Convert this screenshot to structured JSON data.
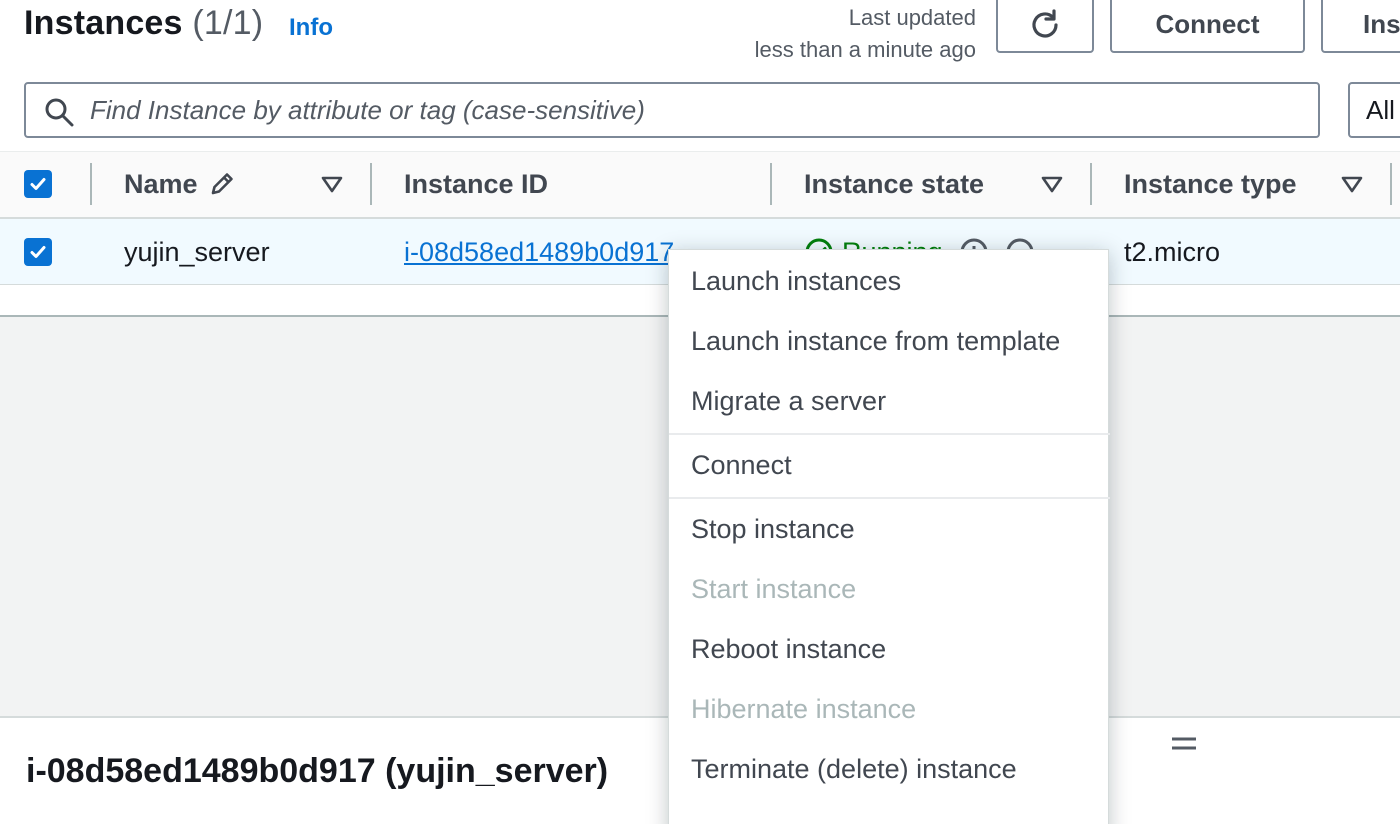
{
  "header": {
    "title": "Instances",
    "count": "(1/1)",
    "info_link": "Info",
    "last_updated_line1": "Last updated",
    "last_updated_line2": "less than a minute ago",
    "refresh_icon": "refresh-icon",
    "connect_label": "Connect",
    "launch_label": "Ins"
  },
  "search": {
    "placeholder": "Find Instance by attribute or tag (case-sensitive)",
    "filter_value": "All"
  },
  "table": {
    "columns": [
      "Name",
      "Instance ID",
      "Instance state",
      "Instance type"
    ],
    "rows": [
      {
        "name": "yujin_server",
        "instance_id": "i-08d58ed1489b0d917",
        "state": "Running",
        "type": "t2.micro",
        "selected": true
      }
    ]
  },
  "details": {
    "title": "i-08d58ed1489b0d917 (yujin_server)"
  },
  "menu": {
    "items": [
      {
        "label": "Launch instances",
        "enabled": true
      },
      {
        "label": "Launch instance from template",
        "enabled": true
      },
      {
        "label": "Migrate a server",
        "enabled": true
      },
      {
        "label": "Connect",
        "enabled": true
      },
      {
        "label": "Stop instance",
        "enabled": true
      },
      {
        "label": "Start instance",
        "enabled": false
      },
      {
        "label": "Reboot instance",
        "enabled": true
      },
      {
        "label": "Hibernate instance",
        "enabled": false
      },
      {
        "label": "Terminate (delete) instance",
        "enabled": true
      }
    ]
  },
  "colors": {
    "accent": "#0972d3",
    "running": "#037f0c",
    "disabled": "#aab7b8"
  }
}
